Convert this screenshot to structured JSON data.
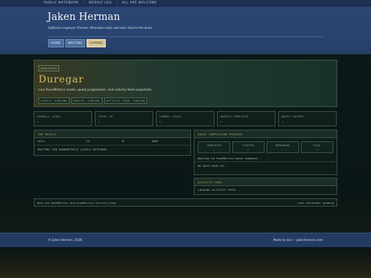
{
  "topbar": {
    "links": [
      "PUBLIC NOTEBOOK",
      "WEEKLY LOG",
      "ALL ARE WELCOME"
    ]
  },
  "header": {
    "title": "Jaken Herman",
    "tagline": "Software engineer. Farmer. Wannabe radio operator. Dad-to-the-bone.",
    "nav": [
      {
        "label": "HOME",
        "active": false
      },
      {
        "label": "WRITING",
        "active": false
      },
      {
        "label": "GAMING",
        "active": true
      }
    ]
  },
  "hero": {
    "chip": "RUNESCAPE",
    "player": "Duregar",
    "description": "Live RuneMetrics levels, quest progression, and activity feed snapshots.",
    "pills": [
      "LEVELS: SYNCING",
      "QUESTS: SYNCING",
      "ACTIVITY FEED: SYNCING"
    ]
  },
  "stats": [
    {
      "label": "OVERALL LEVEL",
      "value": "—"
    },
    {
      "label": "TOTAL XP",
      "value": "—"
    },
    {
      "label": "COMBAT LEVEL",
      "value": "—"
    },
    {
      "label": "QUESTS COMPLETE",
      "value": "—"
    },
    {
      "label": "QUEST POINTS",
      "value": "—"
    }
  ],
  "skills": {
    "title": "TOP SKILLS",
    "columns": [
      "SKILL",
      "LVL",
      "XP",
      "RANK"
    ],
    "message": "WAITING FOR RUNEMETRICS LEVELS RESPONSE..."
  },
  "quests": {
    "title": "QUEST COMPLETION TRACKER",
    "boxes": [
      {
        "label": "COMPLETED",
        "value": "—"
      },
      {
        "label": "STARTED",
        "value": "—"
      },
      {
        "label": "REMAINING",
        "value": "—"
      },
      {
        "label": "TOTAL",
        "value": "—"
      }
    ],
    "status": "Waiting for RuneMetrics quest snapshot...",
    "empty": "NO QUEST DATA YET."
  },
  "activity": {
    "title": "ACTIVITY FEED",
    "message": "LOADING ACTIVITY FEED..."
  },
  "source": {
    "left": "Data via RuneMetrics and RuneMetrics Activity Feed",
    "right": "Last refreshed: pending"
  },
  "footer": {
    "left": "© Jaken Herman, 2026",
    "right": "Made to last — jakenherman.com"
  },
  "colors": {
    "header_blue": "#2c4674",
    "accent_gold": "#e0bc6a",
    "active_tab": "#d8c89a",
    "panel_bg": "#0e1d1a"
  }
}
